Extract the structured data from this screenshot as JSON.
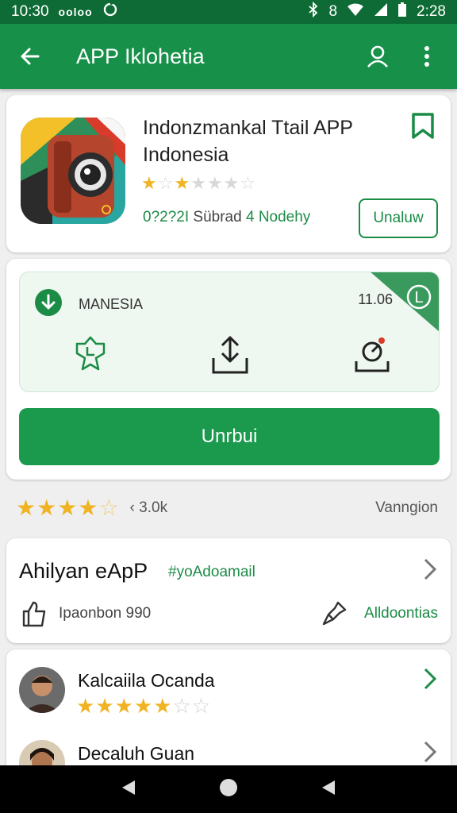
{
  "status": {
    "time": "10:30",
    "carrier": "ooloo",
    "signal_label": "8",
    "battery_time": "2:28"
  },
  "app_bar": {
    "title": "APP Iklohetia"
  },
  "header_card": {
    "name": "Indonzmankal Ttail APP Indonesia",
    "rating": 2,
    "meta_1": "0?2?2I",
    "meta_2": "Sübrad",
    "meta_3": "4 Nodehy",
    "action_label": "Unaluw"
  },
  "install_card": {
    "label": "MANESIA",
    "value": "11.06",
    "corner_letter": "L",
    "button_label": "Unrbui"
  },
  "rating_strip": {
    "stars": 4.5,
    "count": "‹ 3.0k",
    "version": "Vanngion"
  },
  "about_card": {
    "title": "Ahilyan eApP",
    "tag": "#yoAdoamail",
    "sub": "Ipaonbon 990",
    "link": "Alldoontias"
  },
  "reviews": [
    {
      "name": "Kalcaiila Ocanda",
      "stars": 5
    },
    {
      "name": "Decaluh Guan",
      "stars": 0
    }
  ],
  "colors": {
    "primary": "#17914a",
    "dark": "#0e6b35",
    "star": "#f0b323"
  }
}
